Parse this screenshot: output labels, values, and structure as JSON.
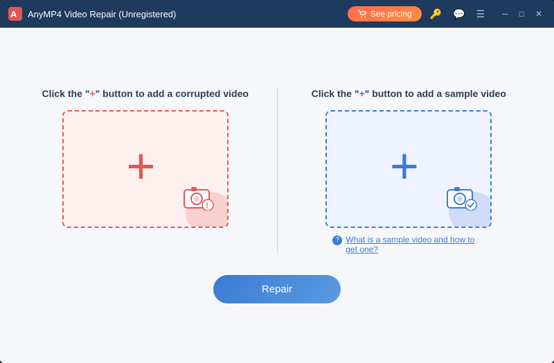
{
  "titleBar": {
    "logo": "anymp4-logo",
    "title": "AnyMP4 Video Repair (Unregistered)",
    "seePricingLabel": "See pricing",
    "icons": [
      "key-icon",
      "message-icon",
      "menu-icon"
    ],
    "windowControls": [
      "minimize",
      "maximize",
      "close"
    ]
  },
  "leftPanel": {
    "label_prefix": "Click the \"",
    "label_plus": "+",
    "label_suffix": "\" button to add a corrupted video",
    "ariaLabel": "Add corrupted video drop zone"
  },
  "rightPanel": {
    "label_prefix": "Click the \"",
    "label_plus": "+",
    "label_suffix": "\" button to add a sample video",
    "ariaLabel": "Add sample video drop zone",
    "helpText": "What is a sample video and how to get one?"
  },
  "repairButton": {
    "label": "Repair"
  }
}
